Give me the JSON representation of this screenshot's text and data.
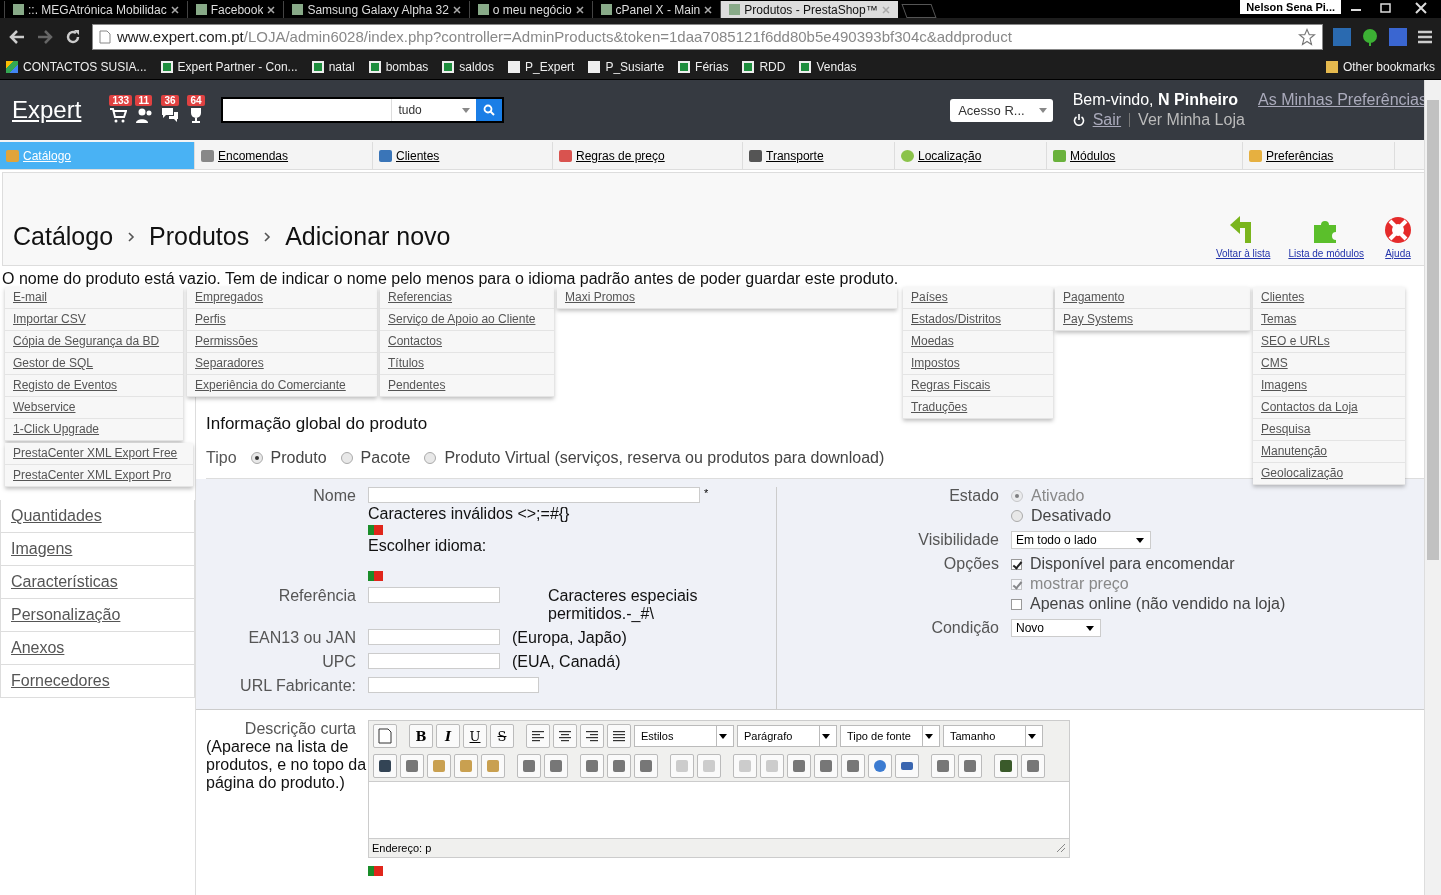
{
  "browser": {
    "tabs": [
      {
        "title": "::. MEGAtrónica Mobilidac",
        "selected": false
      },
      {
        "title": "Facebook",
        "selected": false
      },
      {
        "title": "Samsung Galaxy Alpha 32",
        "selected": false
      },
      {
        "title": "o meu negócio",
        "selected": false
      },
      {
        "title": "cPanel X - Main",
        "selected": false
      },
      {
        "title": "Produtos - PrestaShop™",
        "selected": true
      }
    ],
    "profile": "Nelson Sena Pi...",
    "url_host": "www.expert.com.pt",
    "url_path": "/LOJA/admin6028/index.php?controller=AdminProducts&token=1daa7085121f6dd80b5e490393bf304c&addproduct",
    "bookmarks": [
      "CONTACTOS SUSIA...",
      "Expert Partner - Con...",
      "natal",
      "bombas",
      "saldos",
      "P_Expert",
      "P_Susiarte",
      "Férias",
      "RDD",
      "Vendas"
    ],
    "other_bookmarks": "Other bookmarks"
  },
  "header": {
    "logo": "Expert",
    "badges": [
      "133",
      "11",
      "36",
      "64"
    ],
    "search_scope": "tudo",
    "access_select": "Acesso R...",
    "welcome": "Bem-vindo, **N Pinheiro**",
    "preferences_link": "As Minhas Preferências",
    "logout": "Sair",
    "view_shop": "Ver Minha Loja"
  },
  "nav": [
    {
      "label": "Catálogo",
      "selected": true
    },
    {
      "label": "Encomendas",
      "selected": false
    },
    {
      "label": "Clientes",
      "selected": false
    },
    {
      "label": "Regras de preço",
      "selected": false
    },
    {
      "label": "Transporte",
      "selected": false
    },
    {
      "label": "Localização",
      "selected": false
    },
    {
      "label": "Módulos",
      "selected": false
    },
    {
      "label": "Preferências",
      "selected": false
    }
  ],
  "breadcrumb": [
    "Catálogo",
    "Produtos",
    "Adicionar novo"
  ],
  "toolbar": [
    "Voltar à lista",
    "Lista de módulos",
    "Ajuda"
  ],
  "menus": [
    {
      "items": [
        "E-mail",
        "Importar CSV",
        "Cópia de Segurança da BD",
        "Gestor de SQL",
        "Registo de Eventos",
        "Webservice",
        "1-Click Upgrade"
      ]
    },
    {
      "items": [
        "PrestaCenter XML Export Free",
        "PrestaCenter XML Export Pro"
      ]
    },
    {
      "items": [
        "Empregados",
        "Perfis",
        "Permissões",
        "Separadores",
        "Experiência do Comerciante"
      ]
    },
    {
      "items": [
        "Referencias",
        "Serviço de Apoio ao Cliente",
        "Contactos",
        "Títulos",
        "Pendentes"
      ]
    },
    {
      "items": [
        "Maxi Promos"
      ]
    },
    {
      "items": [
        "Países",
        "Estados/Distritos",
        "Moedas",
        "Impostos",
        "Regras Fiscais",
        "Traduções"
      ]
    },
    {
      "items": [
        "Pagamento",
        "Pay Systems"
      ]
    },
    {
      "items": [
        "Clientes",
        "Temas",
        "SEO e URLs",
        "CMS",
        "Imagens",
        "Contactos da Loja",
        "Pesquisa",
        "Manutenção",
        "Geolocalização"
      ]
    }
  ],
  "error": "O nome do produto está vazio. Tem de indicar o nome pelo menos para o idioma padrão antes de poder guardar este produto.",
  "section_title": "Informação global do produto",
  "sidebar": [
    "Quantidades",
    "Imagens",
    "Características",
    "Personalização",
    "Anexos",
    "Fornecedores"
  ],
  "type": {
    "label": "Tipo",
    "options": [
      {
        "label": "Produto",
        "selected": true
      },
      {
        "label": "Pacote",
        "selected": false
      },
      {
        "label": "Produto Virtual (serviços, reserva ou produtos para download)",
        "selected": false
      }
    ]
  },
  "form": {
    "name_label": "Nome",
    "required": "*",
    "invalid_chars": "Caracteres inválidos <>;=#{}",
    "choose_language": "Escolher idioma:",
    "reference_label": "Referência",
    "reference_hint": "Caracteres especiais permitidos.-_#\\",
    "ean_label": "EAN13 ou JAN",
    "ean_hint": "(Europa, Japão)",
    "upc_label": "UPC",
    "upc_hint": "(EUA, Canadá)",
    "url_label": "URL Fabricante:"
  },
  "status": {
    "label": "Estado",
    "options": [
      {
        "label": "Ativado",
        "selected": true,
        "disabled": true
      },
      {
        "label": "Desativado",
        "selected": false,
        "disabled": false
      }
    ]
  },
  "visibility": {
    "label": "Visibilidade",
    "value": "Em todo o lado"
  },
  "options": {
    "label": "Opções",
    "items": [
      {
        "label": "Disponível para encomendar",
        "checked": true,
        "disabled": false
      },
      {
        "label": "mostrar preço",
        "checked": true,
        "disabled": true
      },
      {
        "label": "Apenas online (não vendido na loja)",
        "checked": false,
        "disabled": false
      }
    ]
  },
  "condition": {
    "label": "Condição",
    "value": "Novo"
  },
  "description": {
    "label": "Descrição curta",
    "hint": "(Aparece na lista de produtos, e no topo da página do produto.)",
    "format_buttons": [
      "B",
      "I",
      "U",
      "S"
    ],
    "dropdowns": [
      "Estilos",
      "Parágrafo",
      "Tipo de fonte",
      "Tamanho"
    ],
    "status": "Endereço: p"
  }
}
